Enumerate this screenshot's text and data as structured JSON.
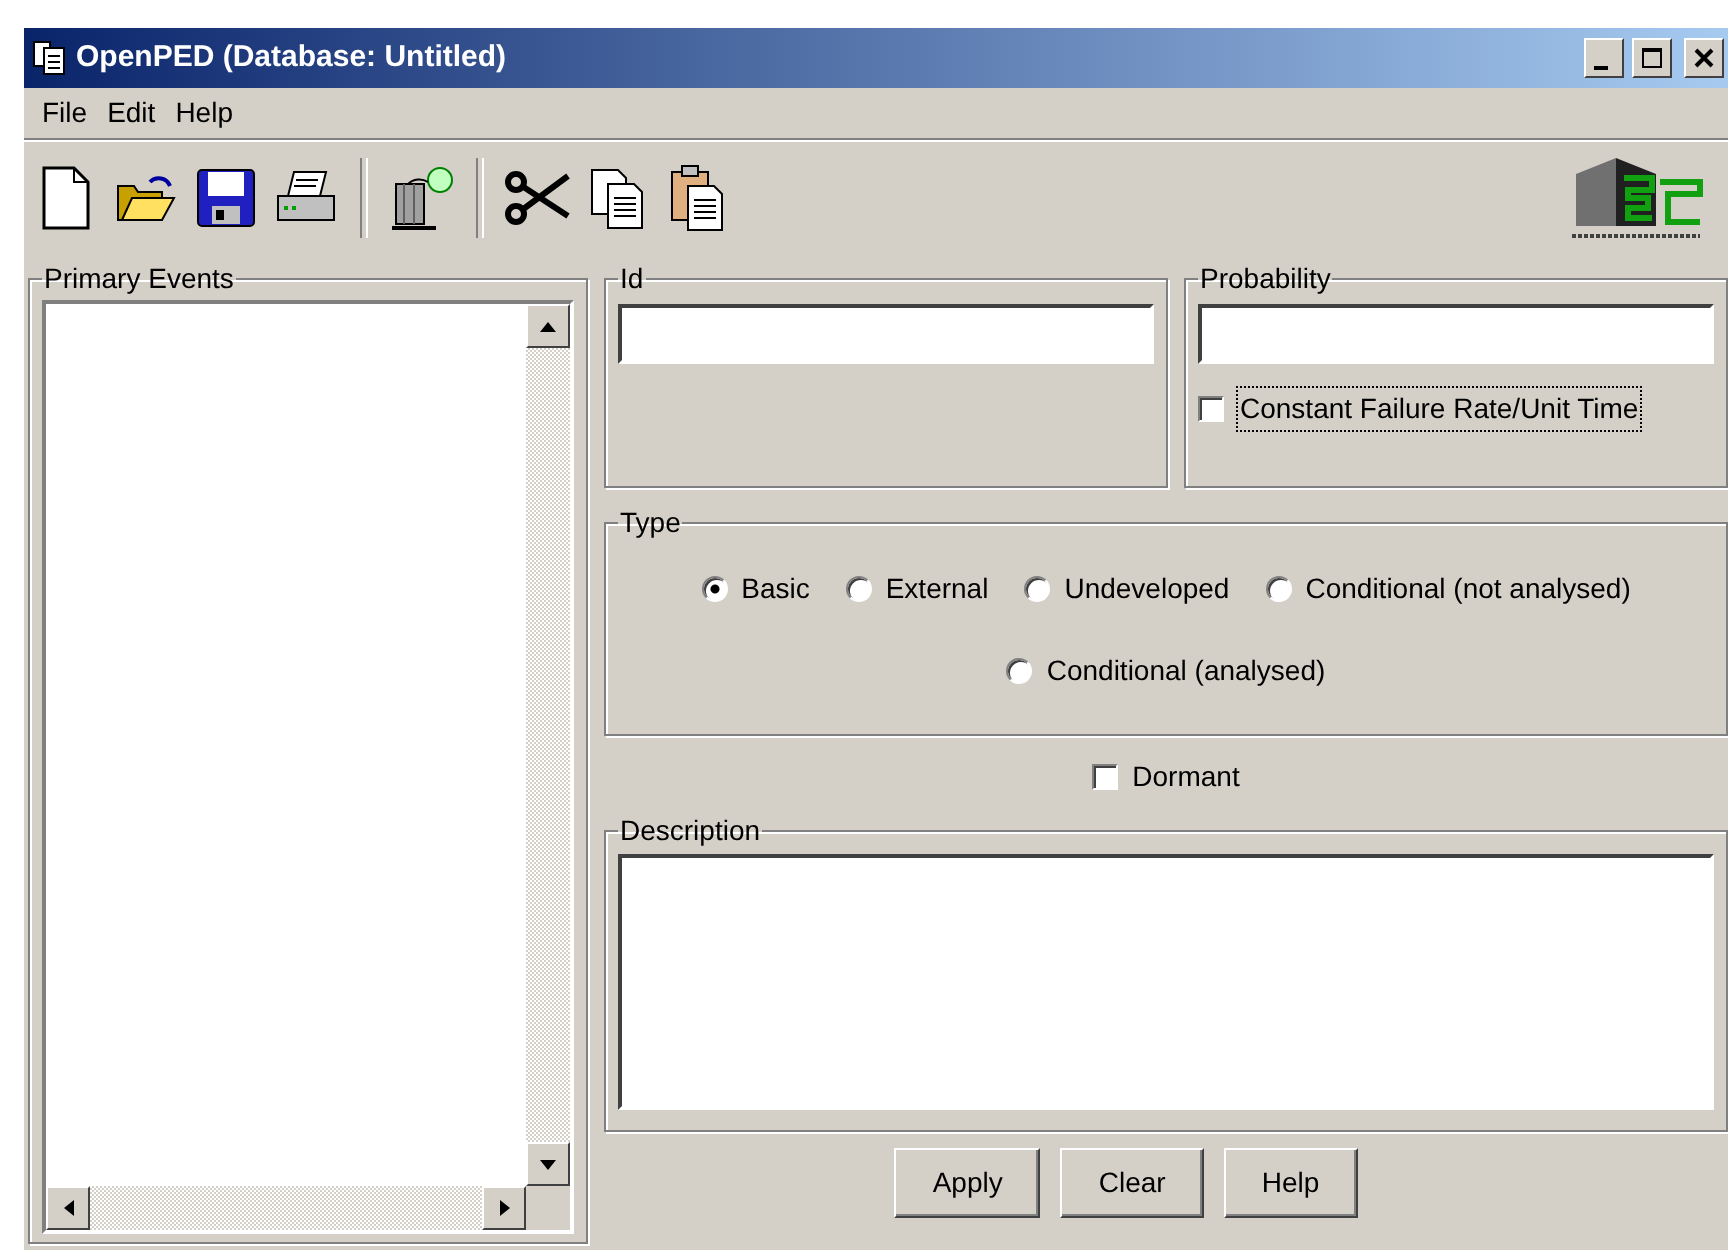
{
  "window": {
    "title": "OpenPED (Database: Untitled)"
  },
  "menu": [
    {
      "label": "File"
    },
    {
      "label": "Edit"
    },
    {
      "label": "Help"
    }
  ],
  "primary_events": {
    "label": "Primary Events"
  },
  "id": {
    "label": "Id"
  },
  "probability": {
    "label": "Probability",
    "constant_rate": {
      "label": "Constant Failure Rate/Unit Time",
      "checked": false
    }
  },
  "type": {
    "label": "Type",
    "options": [
      {
        "label": "Basic",
        "selected": true
      },
      {
        "label": "External",
        "selected": false
      },
      {
        "label": "Undeveloped",
        "selected": false
      },
      {
        "label": "Conditional (not analysed)",
        "selected": false
      },
      {
        "label": "Conditional (analysed)",
        "selected": false
      }
    ]
  },
  "dormant": {
    "label": "Dormant",
    "checked": false
  },
  "description": {
    "label": "Description"
  },
  "buttons": [
    "Apply",
    "Clear",
    "Help"
  ]
}
